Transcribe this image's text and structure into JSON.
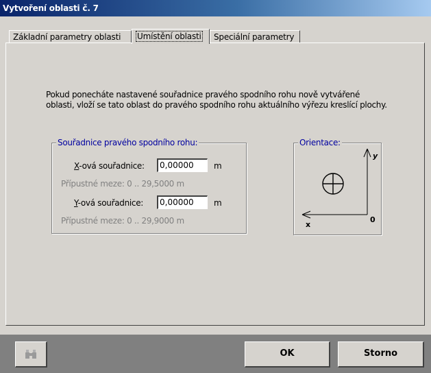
{
  "window": {
    "title": "Vytvoření oblasti č. 7"
  },
  "tabs": [
    {
      "label": "Základní parametry oblasti"
    },
    {
      "label": "Umístění oblasti"
    },
    {
      "label": "Speciální parametry"
    }
  ],
  "info_text": "Pokud ponecháte nastavené souřadnice pravého spodního rohu nově vytvářené oblasti, vloží se tato oblast do pravého spodního rohu aktuálního výřezu kreslící plochy.",
  "coords_group": {
    "title": "Souřadnice pravého spodního rohu:",
    "x": {
      "label_accel": "X",
      "label_rest": "-ová souřadnice:",
      "value": "0,00000",
      "unit": "m",
      "hint": "Přípustné meze: 0 .. 29,5000 m"
    },
    "y": {
      "label_accel": "Y",
      "label_rest": "-ová souřadnice:",
      "value": "0,00000",
      "unit": "m",
      "hint": "Přípustné meze: 0 .. 29,9000 m"
    }
  },
  "orientation_group": {
    "title": "Orientace:",
    "y_label": "y",
    "x_label": "x",
    "origin_label": "0",
    "symbol": "circle-plus-icon"
  },
  "buttons": {
    "binoculars_icon": "binoculars-icon",
    "ok": "OK",
    "cancel": "Storno"
  }
}
